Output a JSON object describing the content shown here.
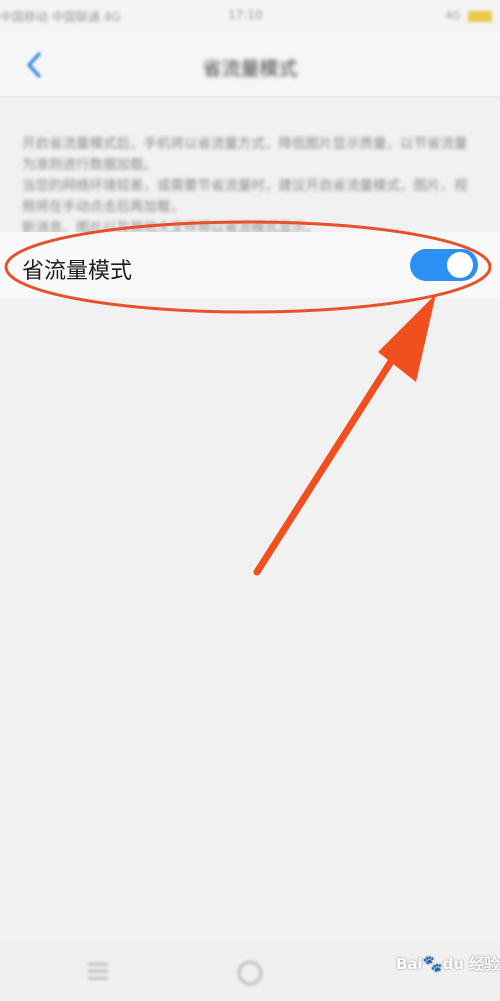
{
  "status_bar": {
    "carrier": "中国移动 中国联通 4G",
    "time": "17:10",
    "signal": "4G"
  },
  "nav": {
    "title": "省流量模式"
  },
  "description": {
    "line1": "开启省流量模式后，手机将以省流量方式，降低图片显示质量，以节省流量为准则进行数据加载。",
    "line2": "当您的网络环境较差，或需要节省流量时，建议开启省流量模式，图片、视频将在手动点击后再加载，",
    "line3": "新消息、图片以及其他大文件将以省流模式显示。"
  },
  "setting": {
    "label": "省流量模式",
    "enabled": true
  },
  "watermark": {
    "brand_a": "Bai",
    "brand_b": "du",
    "suffix": "经验"
  },
  "colors": {
    "toggle_on": "#2a90f2",
    "annotation": "#e8502a",
    "background": "#f1f1f1"
  },
  "icons": {
    "back": "chevron-left-icon",
    "menu": "menu-icon",
    "home": "home-icon"
  }
}
